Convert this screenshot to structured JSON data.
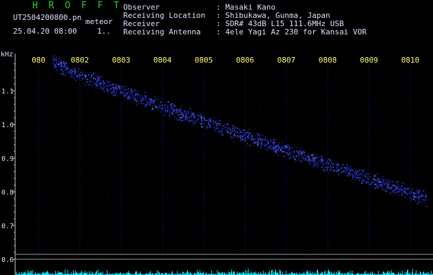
{
  "header": {
    "title": "H R O F F T",
    "file_name": "UT2504200800.pn",
    "tag": "meteor",
    "datetime": "25.04.20 08:00",
    "counter": "1.."
  },
  "info": [
    {
      "key": "Observer",
      "sep": ":",
      "value": "Masaki Kano"
    },
    {
      "key": "Receiving Location",
      "sep": ":",
      "value": "Shibukawa, Gunma, Japan"
    },
    {
      "key": "Receiver",
      "sep": ":",
      "value": "SDR# 43dB L15 111.6MHz USB"
    },
    {
      "key": "Receiving Antenna",
      "sep": ":",
      "value": "4ele Yagi Az 230 for Kansai VOR"
    }
  ],
  "chart_data": {
    "type": "scatter",
    "ylabel": "kHz",
    "yticks": [
      "1.1",
      "1.0",
      "0.9",
      "0.8",
      "0.7",
      "0.6"
    ],
    "xticks": [
      "080",
      "0802",
      "0803",
      "0804",
      "0805",
      "0806",
      "0807",
      "0808",
      "0809",
      "0810"
    ],
    "trace": {
      "x_start": "0801",
      "x_end": "0810",
      "y_start": 1.19,
      "y_end": 0.78
    },
    "colors": {
      "background": "#000000",
      "trace": "#3344ff",
      "grid": "#ffff66",
      "axis": "#cccccc",
      "ticks": "#ffff66",
      "histogram": "#00e5ff"
    }
  }
}
